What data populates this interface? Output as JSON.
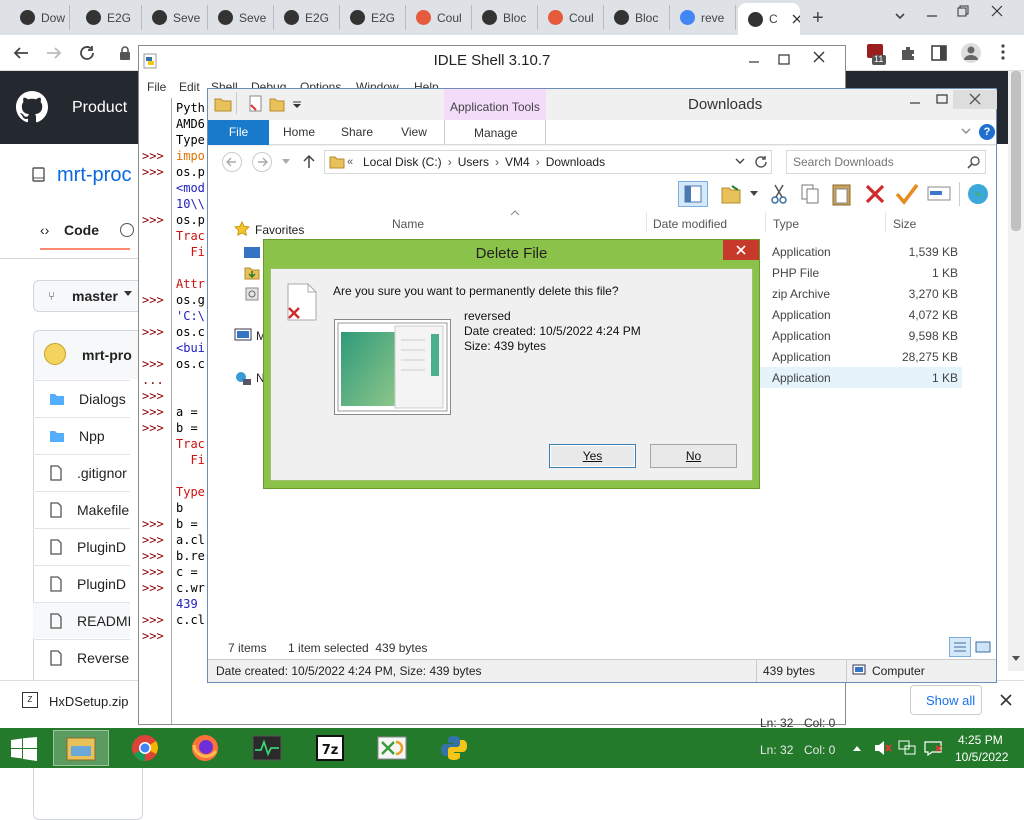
{
  "chrome": {
    "tabs": [
      {
        "label": "Dow",
        "icon": "download-icon",
        "color": "#333"
      },
      {
        "label": "E2G",
        "icon": "github-icon",
        "color": "#333"
      },
      {
        "label": "Seve",
        "icon": "github-icon",
        "color": "#333"
      },
      {
        "label": "Seve",
        "icon": "github-icon",
        "color": "#333"
      },
      {
        "label": "E2G",
        "icon": "github-icon",
        "color": "#333"
      },
      {
        "label": "E2G",
        "icon": "github-icon",
        "color": "#333"
      },
      {
        "label": "Coul",
        "icon": "brave-icon",
        "color": "#e55b3c"
      },
      {
        "label": "Bloc",
        "icon": "github-icon",
        "color": "#333"
      },
      {
        "label": "Coul",
        "icon": "brave-icon",
        "color": "#e55b3c"
      },
      {
        "label": "Bloc",
        "icon": "github-icon",
        "color": "#333"
      },
      {
        "label": "reve",
        "icon": "google-icon",
        "color": "#4285f4"
      },
      {
        "label": "C",
        "icon": "github-icon",
        "color": "#333"
      }
    ],
    "new_tab": "+",
    "extension_badge": "11"
  },
  "github": {
    "header_product": "Product",
    "repo_name": "mrt-proc",
    "code_tab": "Code",
    "branch": "master",
    "owner": "mrt-pro",
    "files": [
      "Dialogs",
      "Npp",
      ".gitignor",
      "Makefile",
      "PluginD",
      "PluginD",
      "READMI",
      "Reverse"
    ]
  },
  "idle": {
    "title": "IDLE Shell 3.10.7",
    "menu": [
      "File",
      "Edit",
      "Shell",
      "Debug",
      "Options",
      "Window",
      "Help"
    ],
    "lines": [
      {
        "p": "",
        "t": "Pyth",
        "c": "#000"
      },
      {
        "p": "",
        "t": "AMD6",
        "c": "#000"
      },
      {
        "p": "",
        "t": "Type",
        "c": "#000"
      },
      {
        "p": ">>>",
        "t": "impo",
        "c": "#e07000"
      },
      {
        "p": ">>>",
        "t": "os.p",
        "c": "#000"
      },
      {
        "p": "",
        "t": "<mod",
        "c": "#2020c0"
      },
      {
        "p": "",
        "t": "10\\\\",
        "c": "#2020c0"
      },
      {
        "p": ">>>",
        "t": "os.p",
        "c": "#000"
      },
      {
        "p": "",
        "t": "Trac",
        "c": "#d01010"
      },
      {
        "p": "",
        "t": "  Fi",
        "c": "#d01010"
      },
      {
        "p": "",
        "t": "",
        "c": "#000"
      },
      {
        "p": "",
        "t": "Attr",
        "c": "#d01010"
      },
      {
        "p": ">>>",
        "t": "os.g",
        "c": "#000"
      },
      {
        "p": "",
        "t": "'C:\\",
        "c": "#2020c0"
      },
      {
        "p": ">>>",
        "t": "os.c",
        "c": "#000"
      },
      {
        "p": "",
        "t": "<bui",
        "c": "#2020c0"
      },
      {
        "p": ">>>",
        "t": "os.c",
        "c": "#000"
      },
      {
        "p": "...",
        "t": "",
        "c": "#000"
      },
      {
        "p": ">>>",
        "t": "",
        "c": "#000"
      },
      {
        "p": ">>>",
        "t": "a =",
        "c": "#000"
      },
      {
        "p": ">>>",
        "t": "b =",
        "c": "#000"
      },
      {
        "p": "",
        "t": "Trac",
        "c": "#d01010"
      },
      {
        "p": "",
        "t": "  Fi",
        "c": "#d01010"
      },
      {
        "p": "",
        "t": "",
        "c": "#000"
      },
      {
        "p": "",
        "t": "Type",
        "c": "#d01010"
      },
      {
        "p": "",
        "t": "b",
        "c": "#000"
      },
      {
        "p": ">>>",
        "t": "b =",
        "c": "#000"
      },
      {
        "p": ">>>",
        "t": "a.cl",
        "c": "#000"
      },
      {
        "p": ">>>",
        "t": "b.re",
        "c": "#000"
      },
      {
        "p": ">>>",
        "t": "c =",
        "c": "#000"
      },
      {
        "p": ">>>",
        "t": "c.wr",
        "c": "#000"
      },
      {
        "p": "",
        "t": "439",
        "c": "#2020c0"
      },
      {
        "p": ">>>",
        "t": "c.cl",
        "c": "#000"
      },
      {
        "p": ">>>",
        "t": "",
        "c": "#000"
      }
    ],
    "status_ln": "Ln: 32",
    "status_col": "Col: 0"
  },
  "explorer": {
    "title": "Downloads",
    "context_tab": "Application Tools",
    "ribbon_tabs": [
      "File",
      "Home",
      "Share",
      "View"
    ],
    "manage_tab": "Manage",
    "path": [
      "Local Disk (C:)",
      "Users",
      "VM4",
      "Downloads"
    ],
    "search_placeholder": "Search Downloads",
    "columns": {
      "name": "Name",
      "date": "Date modified",
      "type": "Type",
      "size": "Size"
    },
    "nav": {
      "favorites": "Favorites",
      "m": "M",
      "n": "N"
    },
    "files": [
      {
        "type": "Application",
        "size": "1,539 KB"
      },
      {
        "type": "PHP File",
        "size": "1 KB"
      },
      {
        "type": "zip Archive",
        "size": "3,270 KB"
      },
      {
        "type": "Application",
        "size": "4,072 KB"
      },
      {
        "type": "Application",
        "size": "9,598 KB"
      },
      {
        "type": "Application",
        "size": "28,275 KB"
      },
      {
        "type": "Application",
        "size": "1 KB"
      }
    ],
    "item_count": "7 items",
    "selection": "1 item selected  439 bytes",
    "details": "Date created: 10/5/2022 4:24 PM, Size: 439 bytes",
    "details_size": "439 bytes",
    "details_location": "Computer"
  },
  "dialog": {
    "title": "Delete File",
    "question": "Are you sure you want to permanently delete this file?",
    "file_name": "reversed",
    "date_created": "Date created: 10/5/2022 4:24 PM",
    "size": "Size: 439 bytes",
    "yes": "Yes",
    "no": "No"
  },
  "download_bar": {
    "file": "HxDSetup.zip",
    "show_all": "Show all"
  },
  "taskbar": {
    "apps": [
      "file-explorer-icon",
      "chrome-icon",
      "firefox-icon",
      "activity-monitor-icon",
      "7zip-icon",
      "hxd-icon",
      "python-icon"
    ],
    "time": "4:25 PM",
    "date": "10/5/2022"
  }
}
